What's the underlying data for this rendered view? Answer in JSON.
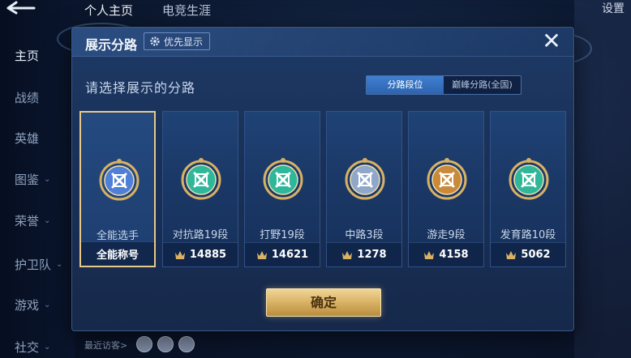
{
  "topnav": {
    "tab_home": "个人主页",
    "tab_career": "电竞生涯",
    "settings": "设置"
  },
  "sidebar": {
    "items": [
      {
        "label": "主页",
        "active": true,
        "chevron": false
      },
      {
        "label": "战绩",
        "active": false,
        "chevron": false
      },
      {
        "label": "英雄",
        "active": false,
        "chevron": false
      },
      {
        "label": "图鉴",
        "active": false,
        "chevron": true
      },
      {
        "label": "荣誉",
        "active": false,
        "chevron": true
      },
      {
        "label": "护卫队",
        "active": false,
        "chevron": true
      },
      {
        "label": "游戏",
        "active": false,
        "chevron": true
      },
      {
        "label": "社交",
        "active": false,
        "chevron": true
      }
    ]
  },
  "visitors": {
    "label": "最近访客>"
  },
  "modal": {
    "title": "展示分路",
    "priority_label": "优先显示",
    "subtitle": "请选择展示的分路",
    "toggle": {
      "option_1": "分路段位",
      "option_2": "巅峰分路(全国)",
      "selected": 1
    },
    "confirm_label": "确定"
  },
  "cards": [
    {
      "name": "全能选手",
      "footer_text": "全能称号",
      "score": null,
      "selected": true,
      "emblem": "all-round-emblem-icon",
      "color": "#4f7fd6"
    },
    {
      "name": "对抗路19段",
      "footer_text": null,
      "score": "14885",
      "selected": false,
      "emblem": "clash-lane-emblem-icon",
      "color": "#2fb79a"
    },
    {
      "name": "打野19段",
      "footer_text": null,
      "score": "14621",
      "selected": false,
      "emblem": "jungle-emblem-icon",
      "color": "#2fb79a"
    },
    {
      "name": "中路3段",
      "footer_text": null,
      "score": "1278",
      "selected": false,
      "emblem": "mid-lane-emblem-icon",
      "color": "#8fa7c8"
    },
    {
      "name": "游走9段",
      "footer_text": null,
      "score": "4158",
      "selected": false,
      "emblem": "roam-emblem-icon",
      "color": "#c98a3a"
    },
    {
      "name": "发育路10段",
      "footer_text": null,
      "score": "5062",
      "selected": false,
      "emblem": "farm-lane-emblem-icon",
      "color": "#2fb79a"
    }
  ],
  "colors": {
    "accent_gold": "#d9b164",
    "selected_border": "#e6c98a",
    "toggle_active": "#3f7fcf"
  }
}
